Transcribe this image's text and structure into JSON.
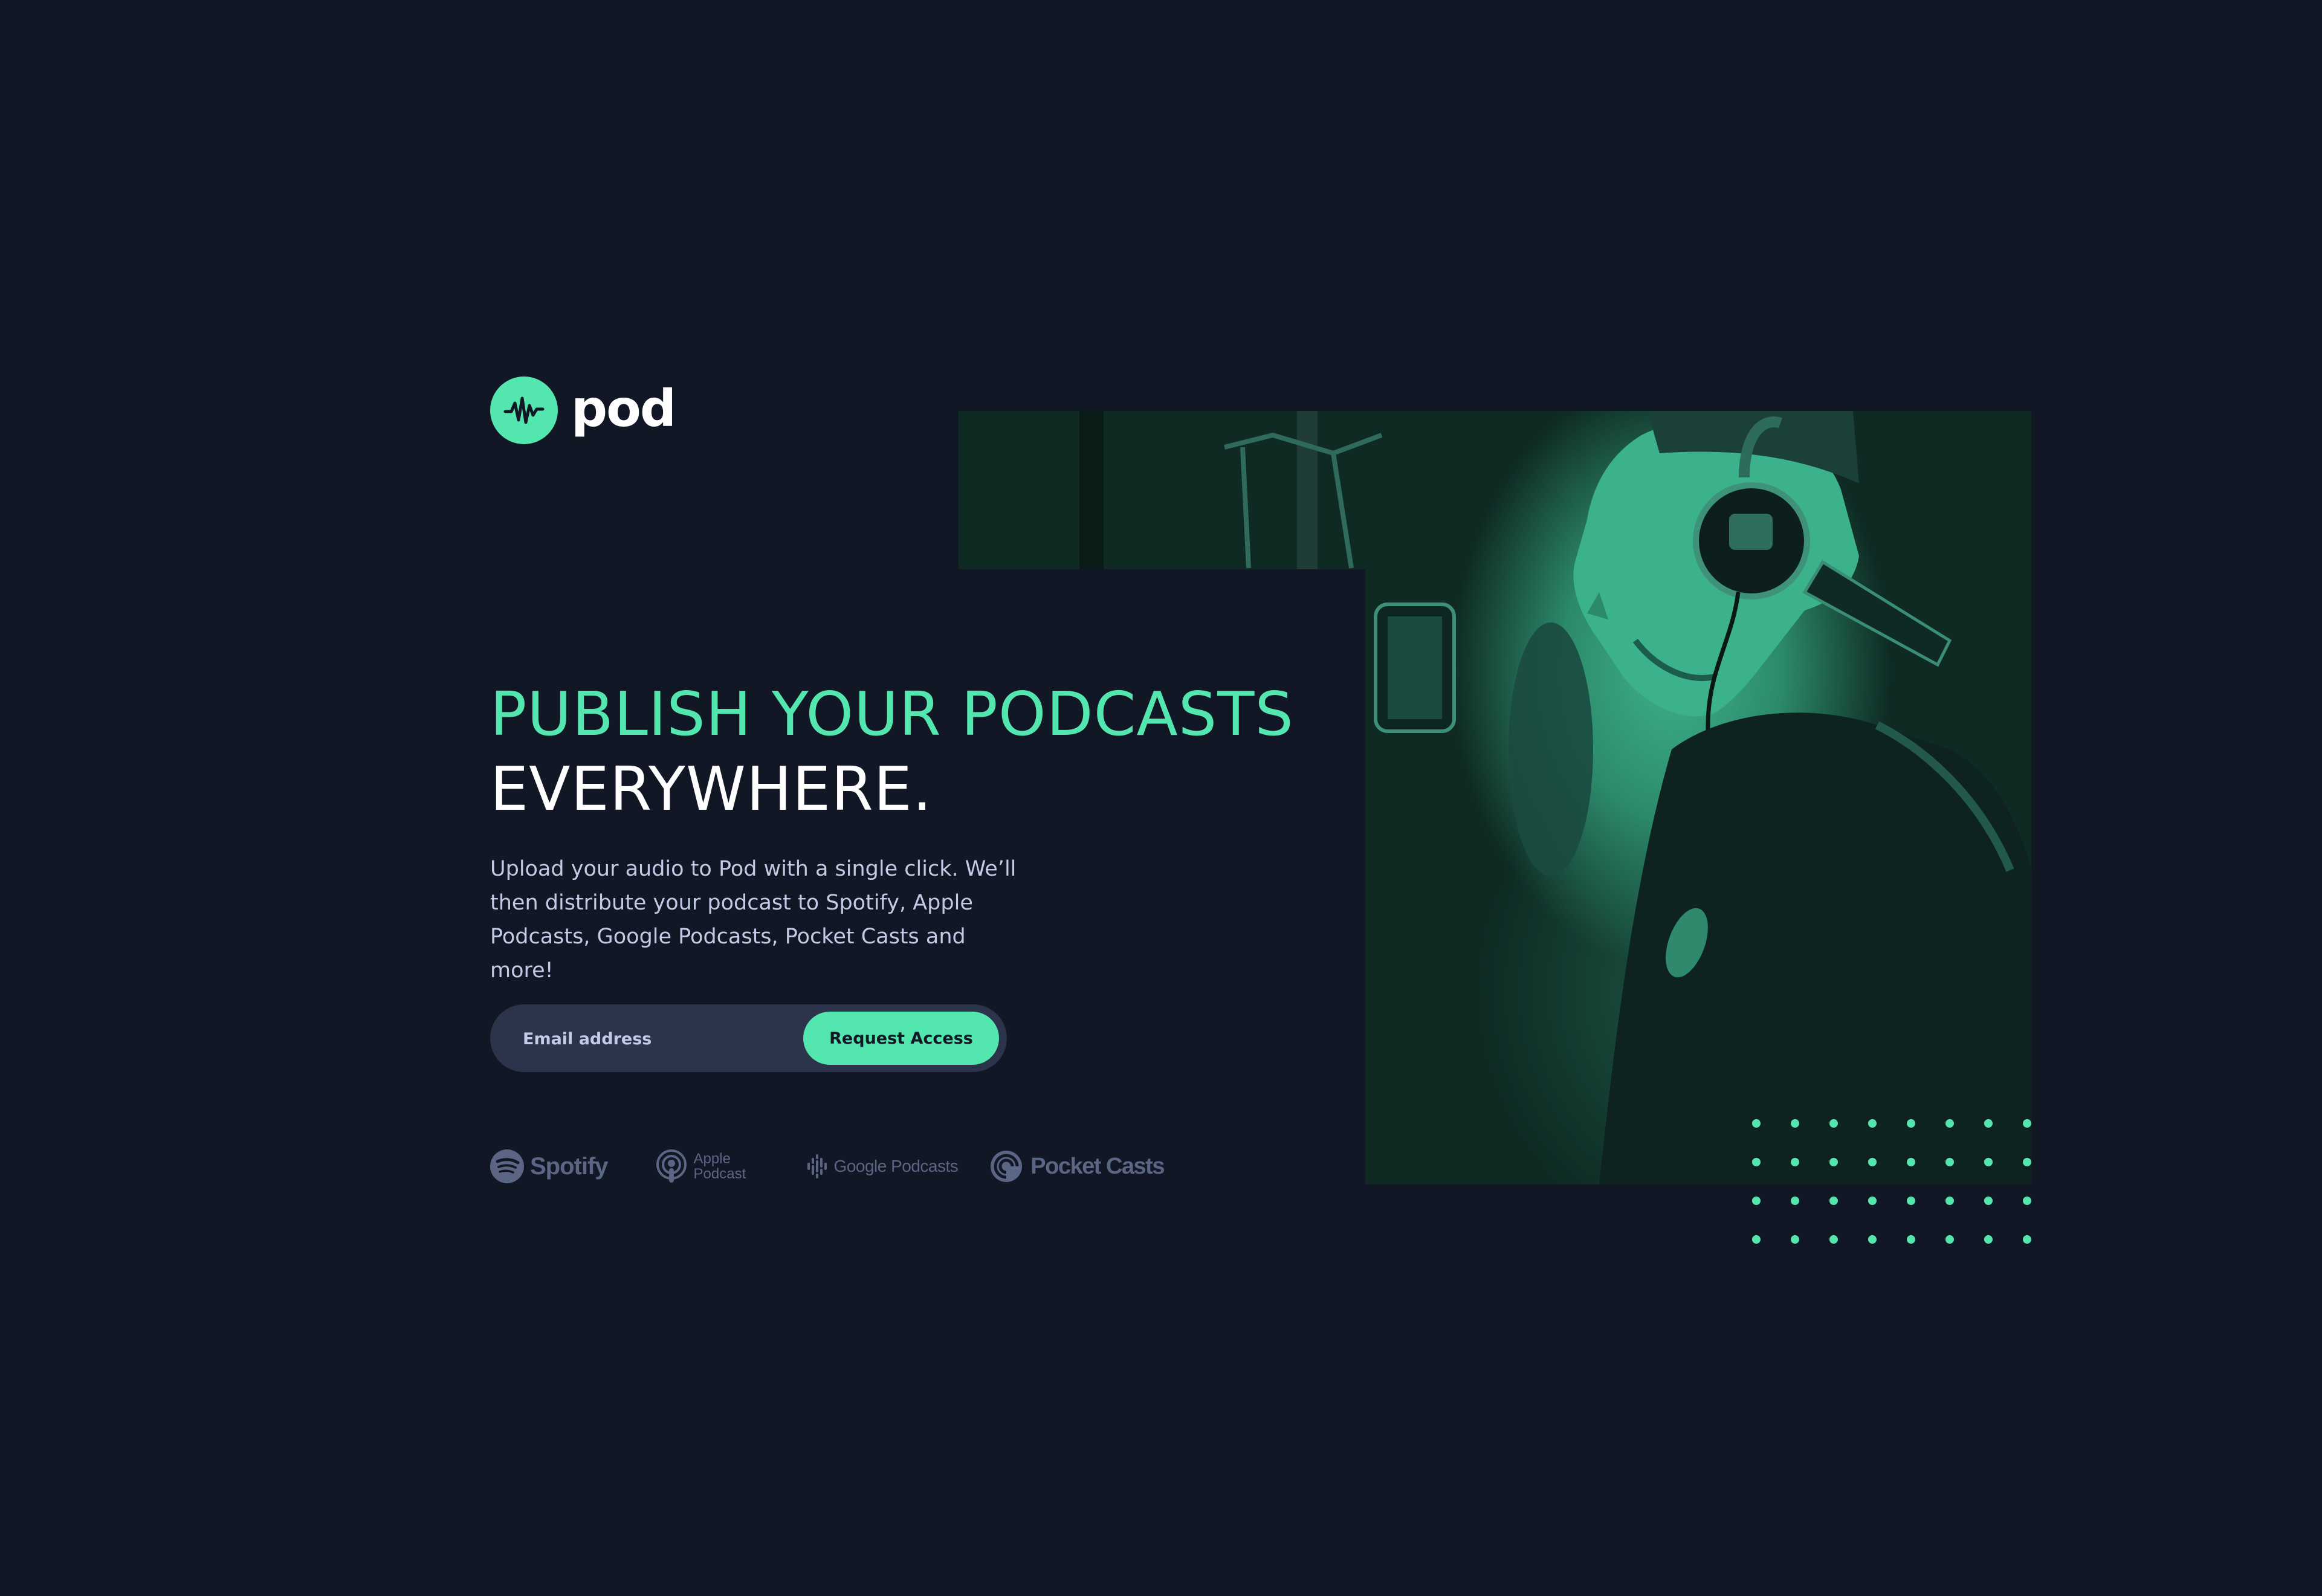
{
  "brand": {
    "name": "pod",
    "logo_icon": "soundwave-icon",
    "accent_color": "#54e6af",
    "background_color": "#121725"
  },
  "hero": {
    "headline_line1": "PUBLISH YOUR PODCASTS",
    "headline_line2": "EVERYWHERE.",
    "description": "Upload your audio to Pod with a single click. We’ll then distribute your podcast to Spotify, Apple Podcasts, Google Podcasts, Pocket Casts and more!"
  },
  "signup": {
    "email_placeholder": "Email address",
    "email_value": "",
    "button_label": "Request Access"
  },
  "platforms": [
    {
      "name": "Spotify",
      "icon": "spotify-icon"
    },
    {
      "name": "Apple Podcast",
      "line1": "Apple",
      "line2": "Podcast",
      "icon": "apple-podcast-icon"
    },
    {
      "name": "Google Podcasts",
      "icon": "google-podcasts-icon"
    },
    {
      "name": "Pocket Casts",
      "icon": "pocket-casts-icon"
    }
  ],
  "image": {
    "description": "podcaster-with-headphones-at-microphone",
    "tint_color": "#54e6af"
  }
}
